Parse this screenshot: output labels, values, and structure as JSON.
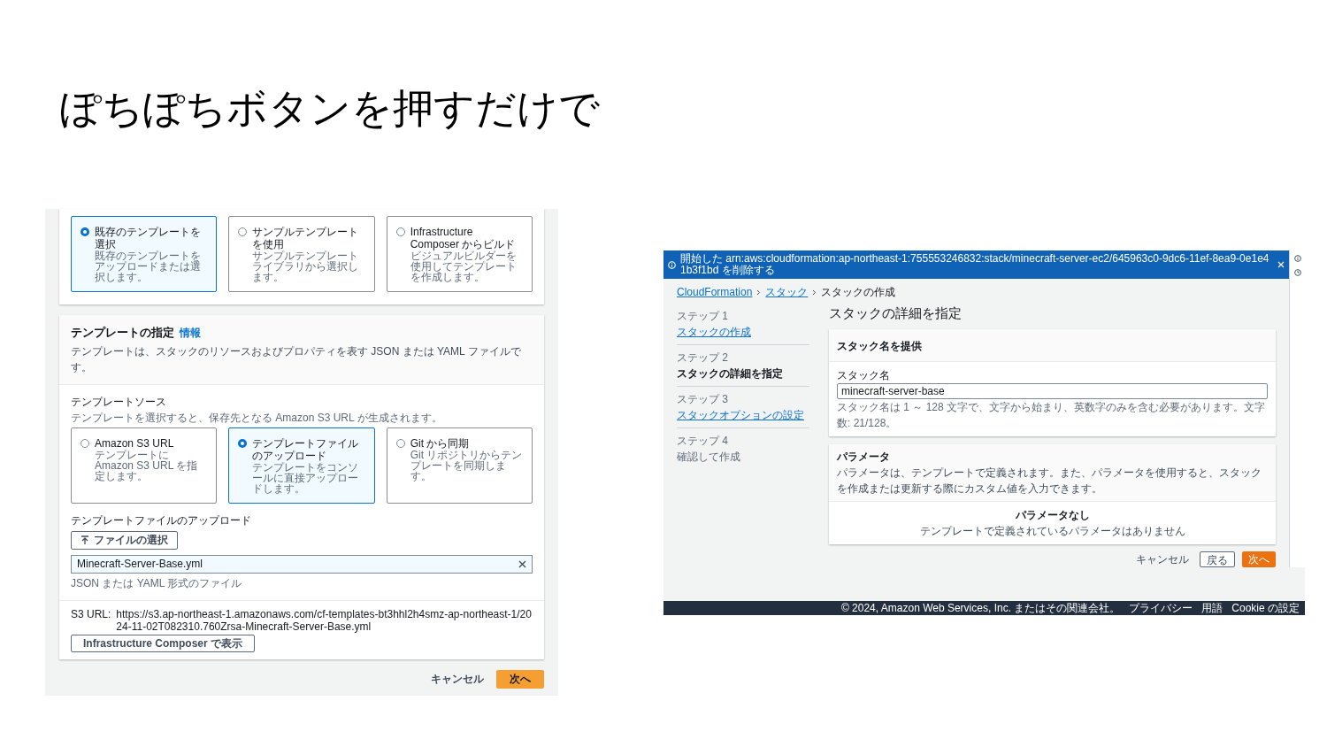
{
  "slide_title": "ぽちぽちボタンを押すだけで",
  "left_screen": {
    "prepare_options": [
      {
        "title": "既存のテンプレートを選択",
        "description": "既存のテンプレートをアップロードまたは選択します。",
        "selected": true
      },
      {
        "title": "サンプルテンプレートを使用",
        "description": "サンプルテンプレートライブラリから選択します。",
        "selected": false
      },
      {
        "title": "Infrastructure Composer からビルド",
        "description": "ビジュアルビルダーを使用してテンプレートを作成します。",
        "selected": false
      }
    ],
    "template_section": {
      "heading": "テンプレートの指定",
      "info_link": "情報",
      "description": "テンプレートは、スタックのリソースおよびプロパティを表す JSON または YAML ファイルです。"
    },
    "template_source": {
      "label": "テンプレートソース",
      "hint": "テンプレートを選択すると、保存先となる Amazon S3 URL が生成されます。",
      "options": [
        {
          "title": "Amazon S3 URL",
          "description": "テンプレートに Amazon S3 URL を指定します。",
          "selected": false
        },
        {
          "title": "テンプレートファイルのアップロード",
          "description": "テンプレートをコンソールに直接アップロードします。",
          "selected": true
        },
        {
          "title": "Git から同期",
          "description": "Git リポジトリからテンプレートを同期します。",
          "selected": false
        }
      ]
    },
    "upload": {
      "label": "テンプレートファイルのアップロード",
      "button": "ファイルの選択",
      "file_name": "Minecraft-Server-Base.yml",
      "hint": "JSON または YAML 形式のファイル"
    },
    "s3_url": {
      "label": "S3 URL:",
      "value": "https://s3.ap-northeast-1.amazonaws.com/cf-templates-bt3hhl2h4smz-ap-northeast-1/2024-11-02T082310.760Zrsa-Minecraft-Server-Base.yml",
      "button": "Infrastructure Composer で表示"
    },
    "footer": {
      "cancel": "キャンセル",
      "next": "次へ"
    }
  },
  "right_screen": {
    "banner": {
      "text": "開始した arn:aws:cloudformation:ap-northeast-1:755553246832:stack/minecraft-server-ec2/645963c0-9dc6-11ef-8ea9-0e1e41b3f1bd を削除する"
    },
    "breadcrumb": [
      {
        "label": "CloudFormation",
        "link": true
      },
      {
        "label": "スタック",
        "link": true
      },
      {
        "label": "スタックの作成",
        "link": false
      }
    ],
    "steps": [
      {
        "step": "ステップ 1",
        "title": "スタックの作成",
        "selected": false,
        "link": true
      },
      {
        "step": "ステップ 2",
        "title": "スタックの詳細を指定",
        "selected": true,
        "link": false
      },
      {
        "step": "ステップ 3",
        "title": "スタックオプションの設定",
        "selected": false,
        "link": true
      },
      {
        "step": "ステップ 4",
        "title": "確認して作成",
        "selected": false,
        "link": false
      }
    ],
    "heading": "スタックの詳細を指定",
    "stack_name": {
      "title": "スタック名を提供",
      "label": "スタック名",
      "value": "minecraft-server-base",
      "hint": "スタック名は 1 ～ 128 文字で、文字から始まり、英数字のみを含む必要があります。文字数: 21/128。"
    },
    "parameters": {
      "title": "パラメータ",
      "description": "パラメータは、テンプレートで定義されます。また、パラメータを使用すると、スタックを作成または更新する際にカスタム値を入力できます。",
      "empty_title": "パラメータなし",
      "empty_text": "テンプレートで定義されているパラメータはありません"
    },
    "buttons": {
      "cancel": "キャンセル",
      "back": "戻る",
      "next": "次へ"
    },
    "footer": {
      "copyright": "© 2024, Amazon Web Services, Inc. またはその関連会社。",
      "links": [
        "プライバシー",
        "用語",
        "Cookie の設定"
      ]
    }
  }
}
